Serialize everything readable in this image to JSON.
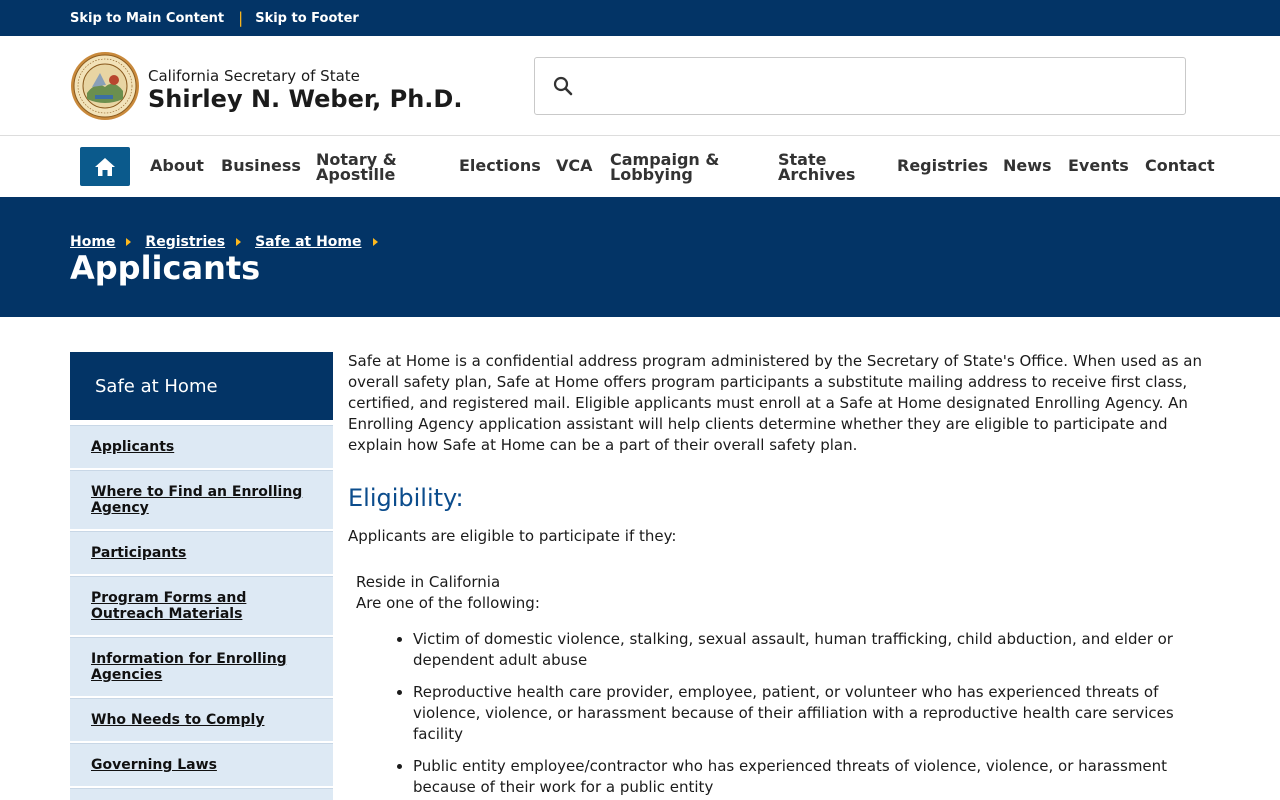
{
  "utility": {
    "skip_main": "Skip to Main Content",
    "separator": "|",
    "skip_footer": "Skip to Footer"
  },
  "branding": {
    "top_line": "California Secretary of State",
    "name": "Shirley N. Weber, Ph.D.",
    "seal_text": "THE GREAT SEAL OF THE STATE OF CALIFORNIA"
  },
  "search": {
    "icon": "search-icon",
    "placeholder": ""
  },
  "nav": {
    "home_icon": "home-icon",
    "items": [
      {
        "line1": "About",
        "line2": ""
      },
      {
        "line1": "Business",
        "line2": ""
      },
      {
        "line1": "Notary &",
        "line2": "Apostille"
      },
      {
        "line1": "Elections",
        "line2": ""
      },
      {
        "line1": "VCA",
        "line2": ""
      },
      {
        "line1": "Campaign &",
        "line2": "Lobbying"
      },
      {
        "line1": "State",
        "line2": "Archives"
      },
      {
        "line1": "Registries",
        "line2": ""
      },
      {
        "line1": "News",
        "line2": ""
      },
      {
        "line1": "Events",
        "line2": ""
      },
      {
        "line1": "Contact",
        "line2": ""
      }
    ]
  },
  "breadcrumb": [
    "Home",
    "Registries",
    "Safe at Home"
  ],
  "page_title": "Applicants",
  "sidenav": {
    "heading": "Safe at Home",
    "items": [
      {
        "line1": "Applicants",
        "line2": ""
      },
      {
        "line1": "Where to Find an Enrolling",
        "line2": "Agency"
      },
      {
        "line1": "Participants",
        "line2": ""
      },
      {
        "line1": "Program Forms and",
        "line2": "Outreach Materials"
      },
      {
        "line1": "Information for Enrolling",
        "line2": "Agencies"
      },
      {
        "line1": "Who Needs to Comply",
        "line2": ""
      },
      {
        "line1": "Governing Laws",
        "line2": ""
      }
    ]
  },
  "content": {
    "intro": "Safe at Home is a confidential address program administered by the Secretary of State's Office. When used as an overall safety plan, Safe at Home offers program participants a substitute mailing address to receive first class, certified, and registered mail. Eligible applicants must enroll at a Safe at Home designated Enrolling Agency. An Enrolling Agency application assistant will help clients determine whether they are eligible to participate and explain how Safe at Home can be a part of their overall safety plan.",
    "heading": "Eligibility:",
    "eligible_intro": "Applicants are eligible to participate if they:",
    "reside": "Reside in California",
    "one_of": "Are one of the following:",
    "bullets": [
      "Victim of domestic violence, stalking, sexual assault, human trafficking, child abduction, and elder or dependent adult abuse",
      "Reproductive health care provider, employee, patient, or volunteer who has experienced threats of violence, violence, or harassment because of their affiliation with a reproductive health care services facility",
      "Public entity employee/contractor who has experienced threats of violence, violence, or harassment because of their work for a public entity"
    ]
  },
  "colors": {
    "primary_navy": "#033466",
    "accent_gold": "#fdb81e",
    "home_button": "#0b5a8c",
    "sidenav_item_bg": "#dde9f4",
    "heading_blue": "#0b4c8c"
  }
}
